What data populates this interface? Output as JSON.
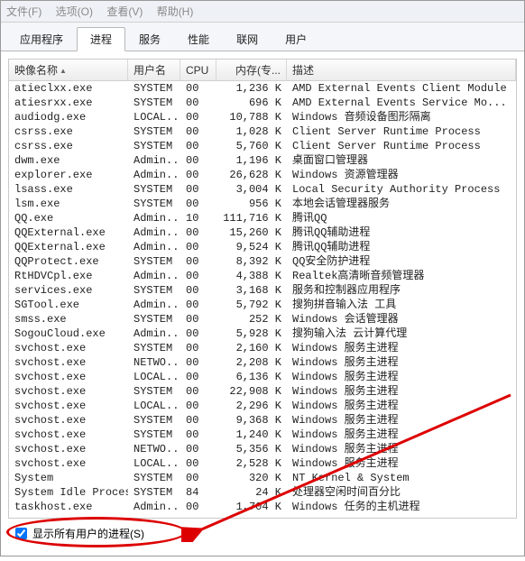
{
  "menu": {
    "file": "文件(F)",
    "options": "选项(O)",
    "view": "查看(V)",
    "help": "帮助(H)"
  },
  "tabs": {
    "apps": "应用程序",
    "processes": "进程",
    "services": "服务",
    "performance": "性能",
    "network": "联网",
    "users": "用户"
  },
  "columns": {
    "name": "映像名称",
    "user": "用户名",
    "cpu": "CPU",
    "mem": "内存(专...",
    "desc": "描述"
  },
  "footer": {
    "showAll": "显示所有用户的进程(S)"
  },
  "processes": [
    {
      "name": "atieclxx.exe",
      "user": "SYSTEM",
      "cpu": "00",
      "mem": "1,236 K",
      "desc": "AMD External Events Client Module"
    },
    {
      "name": "atiesrxx.exe",
      "user": "SYSTEM",
      "cpu": "00",
      "mem": "696 K",
      "desc": "AMD External Events Service Mo..."
    },
    {
      "name": "audiodg.exe",
      "user": "LOCAL...",
      "cpu": "00",
      "mem": "10,788 K",
      "desc": "Windows 音频设备图形隔离"
    },
    {
      "name": "csrss.exe",
      "user": "SYSTEM",
      "cpu": "00",
      "mem": "1,028 K",
      "desc": "Client Server Runtime Process"
    },
    {
      "name": "csrss.exe",
      "user": "SYSTEM",
      "cpu": "00",
      "mem": "5,760 K",
      "desc": "Client Server Runtime Process"
    },
    {
      "name": "dwm.exe",
      "user": "Admin...",
      "cpu": "00",
      "mem": "1,196 K",
      "desc": "桌面窗口管理器"
    },
    {
      "name": "explorer.exe",
      "user": "Admin...",
      "cpu": "00",
      "mem": "26,628 K",
      "desc": "Windows 资源管理器"
    },
    {
      "name": "lsass.exe",
      "user": "SYSTEM",
      "cpu": "00",
      "mem": "3,004 K",
      "desc": "Local Security Authority Process"
    },
    {
      "name": "lsm.exe",
      "user": "SYSTEM",
      "cpu": "00",
      "mem": "956 K",
      "desc": "本地会话管理器服务"
    },
    {
      "name": "QQ.exe",
      "user": "Admin...",
      "cpu": "10",
      "mem": "111,716 K",
      "desc": "腾讯QQ"
    },
    {
      "name": "QQExternal.exe",
      "user": "Admin...",
      "cpu": "00",
      "mem": "15,260 K",
      "desc": "腾讯QQ辅助进程"
    },
    {
      "name": "QQExternal.exe",
      "user": "Admin...",
      "cpu": "00",
      "mem": "9,524 K",
      "desc": "腾讯QQ辅助进程"
    },
    {
      "name": "QQProtect.exe",
      "user": "SYSTEM",
      "cpu": "00",
      "mem": "8,392 K",
      "desc": "QQ安全防护进程"
    },
    {
      "name": "RtHDVCpl.exe",
      "user": "Admin...",
      "cpu": "00",
      "mem": "4,388 K",
      "desc": "Realtek高清晰音频管理器"
    },
    {
      "name": "services.exe",
      "user": "SYSTEM",
      "cpu": "00",
      "mem": "3,168 K",
      "desc": "服务和控制器应用程序"
    },
    {
      "name": "SGTool.exe",
      "user": "Admin...",
      "cpu": "00",
      "mem": "5,792 K",
      "desc": "搜狗拼音输入法 工具"
    },
    {
      "name": "smss.exe",
      "user": "SYSTEM",
      "cpu": "00",
      "mem": "252 K",
      "desc": "Windows 会话管理器"
    },
    {
      "name": "SogouCloud.exe",
      "user": "Admin...",
      "cpu": "00",
      "mem": "5,928 K",
      "desc": "搜狗输入法 云计算代理"
    },
    {
      "name": "svchost.exe",
      "user": "SYSTEM",
      "cpu": "00",
      "mem": "2,160 K",
      "desc": "Windows 服务主进程"
    },
    {
      "name": "svchost.exe",
      "user": "NETWO...",
      "cpu": "00",
      "mem": "2,208 K",
      "desc": "Windows 服务主进程"
    },
    {
      "name": "svchost.exe",
      "user": "LOCAL...",
      "cpu": "00",
      "mem": "6,136 K",
      "desc": "Windows 服务主进程"
    },
    {
      "name": "svchost.exe",
      "user": "SYSTEM",
      "cpu": "00",
      "mem": "22,908 K",
      "desc": "Windows 服务主进程"
    },
    {
      "name": "svchost.exe",
      "user": "LOCAL...",
      "cpu": "00",
      "mem": "2,296 K",
      "desc": "Windows 服务主进程"
    },
    {
      "name": "svchost.exe",
      "user": "SYSTEM",
      "cpu": "00",
      "mem": "9,368 K",
      "desc": "Windows 服务主进程"
    },
    {
      "name": "svchost.exe",
      "user": "SYSTEM",
      "cpu": "00",
      "mem": "1,240 K",
      "desc": "Windows 服务主进程"
    },
    {
      "name": "svchost.exe",
      "user": "NETWO...",
      "cpu": "00",
      "mem": "5,356 K",
      "desc": "Windows 服务主进程"
    },
    {
      "name": "svchost.exe",
      "user": "LOCAL...",
      "cpu": "00",
      "mem": "2,528 K",
      "desc": "Windows 服务主进程"
    },
    {
      "name": "System",
      "user": "SYSTEM",
      "cpu": "00",
      "mem": "320 K",
      "desc": "NT Kernel & System"
    },
    {
      "name": "System Idle Process",
      "user": "SYSTEM",
      "cpu": "84",
      "mem": "24 K",
      "desc": "处理器空闲时间百分比"
    },
    {
      "name": "taskhost.exe",
      "user": "Admin...",
      "cpu": "00",
      "mem": "1,704 K",
      "desc": "Windows 任务的主机进程"
    }
  ]
}
